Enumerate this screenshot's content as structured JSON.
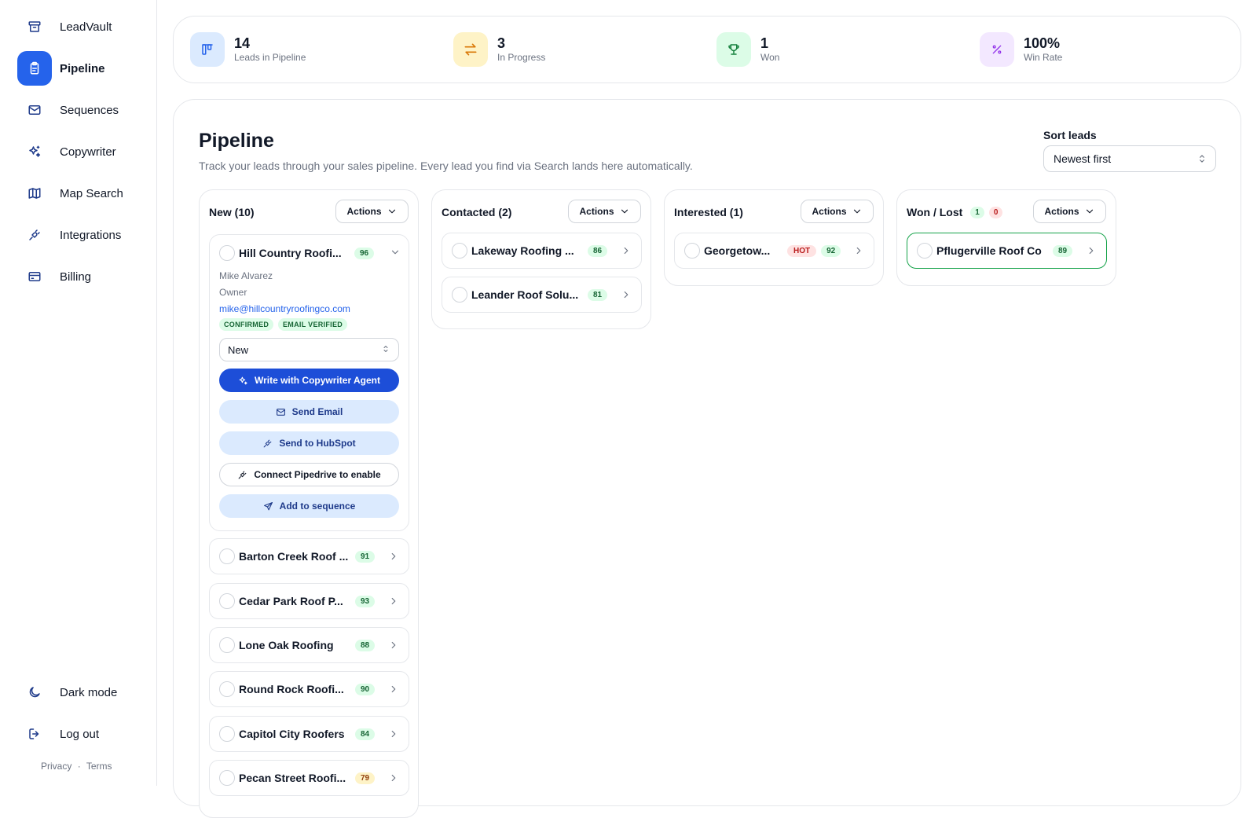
{
  "sidebar": {
    "brand": "LeadVault",
    "items": [
      {
        "label": "Pipeline",
        "icon": "clipboard-icon"
      },
      {
        "label": "Sequences",
        "icon": "mail-icon"
      },
      {
        "label": "Copywriter",
        "icon": "sparkles-icon"
      },
      {
        "label": "Map Search",
        "icon": "map-icon"
      },
      {
        "label": "Integrations",
        "icon": "plug-icon"
      },
      {
        "label": "Billing",
        "icon": "credit-card-icon"
      }
    ],
    "dark_mode": "Dark mode",
    "logout": "Log out",
    "privacy": "Privacy",
    "separator": "·",
    "terms": "Terms"
  },
  "stats": [
    {
      "value": "14",
      "label": "Leads in Pipeline",
      "icon": "kanban-icon",
      "color": "#2563eb",
      "bg": "#dbeafe"
    },
    {
      "value": "3",
      "label": "In Progress",
      "icon": "arrows-swap-icon",
      "color": "#d97706",
      "bg": "#fef3c7"
    },
    {
      "value": "1",
      "label": "Won",
      "icon": "trophy-icon",
      "color": "#15803d",
      "bg": "#dcfce7"
    },
    {
      "value": "100%",
      "label": "Win Rate",
      "icon": "percent-icon",
      "color": "#9333ea",
      "bg": "#f3e8ff"
    }
  ],
  "pipeline": {
    "title": "Pipeline",
    "subtitle": "Track your leads through your sales pipeline. Every lead you find via Search lands here automatically.",
    "sort_label": "Sort leads",
    "sort_value": "Newest first",
    "actions_label": "Actions"
  },
  "columns": {
    "new": {
      "title": "New (10)",
      "expanded": {
        "name": "Hill Country Roofi...",
        "score": "96",
        "contact": "Mike Alvarez",
        "role": "Owner",
        "email": "mike@hillcountryroofingco.com",
        "tags": [
          "CONFIRMED",
          "EMAIL VERIFIED"
        ],
        "stage": "New",
        "buttons": {
          "copywriter": "Write with Copywriter Agent",
          "send_email": "Send Email",
          "hubspot": "Send to HubSpot",
          "pipedrive": "Connect Pipedrive to enable",
          "sequence": "Add to sequence"
        }
      },
      "cards": [
        {
          "name": "Barton Creek Roof ...",
          "score": "91"
        },
        {
          "name": "Cedar Park Roof P...",
          "score": "93"
        },
        {
          "name": "Lone Oak Roofing",
          "score": "88"
        },
        {
          "name": "Round Rock Roofi...",
          "score": "90"
        },
        {
          "name": "Capitol City Roofers",
          "score": "84"
        },
        {
          "name": "Pecan Street Roofi...",
          "score": "79"
        }
      ]
    },
    "contacted": {
      "title": "Contacted (2)",
      "cards": [
        {
          "name": "Lakeway Roofing ...",
          "score": "86"
        },
        {
          "name": "Leander Roof Solu...",
          "score": "81"
        }
      ]
    },
    "interested": {
      "title": "Interested (1)",
      "cards": [
        {
          "name": "Georgetow...",
          "hot": "HOT",
          "score": "92"
        }
      ]
    },
    "wonlost": {
      "title": "Won / Lost",
      "won_count": "1",
      "lost_count": "0",
      "cards": [
        {
          "name": "Pflugerville Roof Co",
          "score": "89"
        }
      ]
    }
  }
}
